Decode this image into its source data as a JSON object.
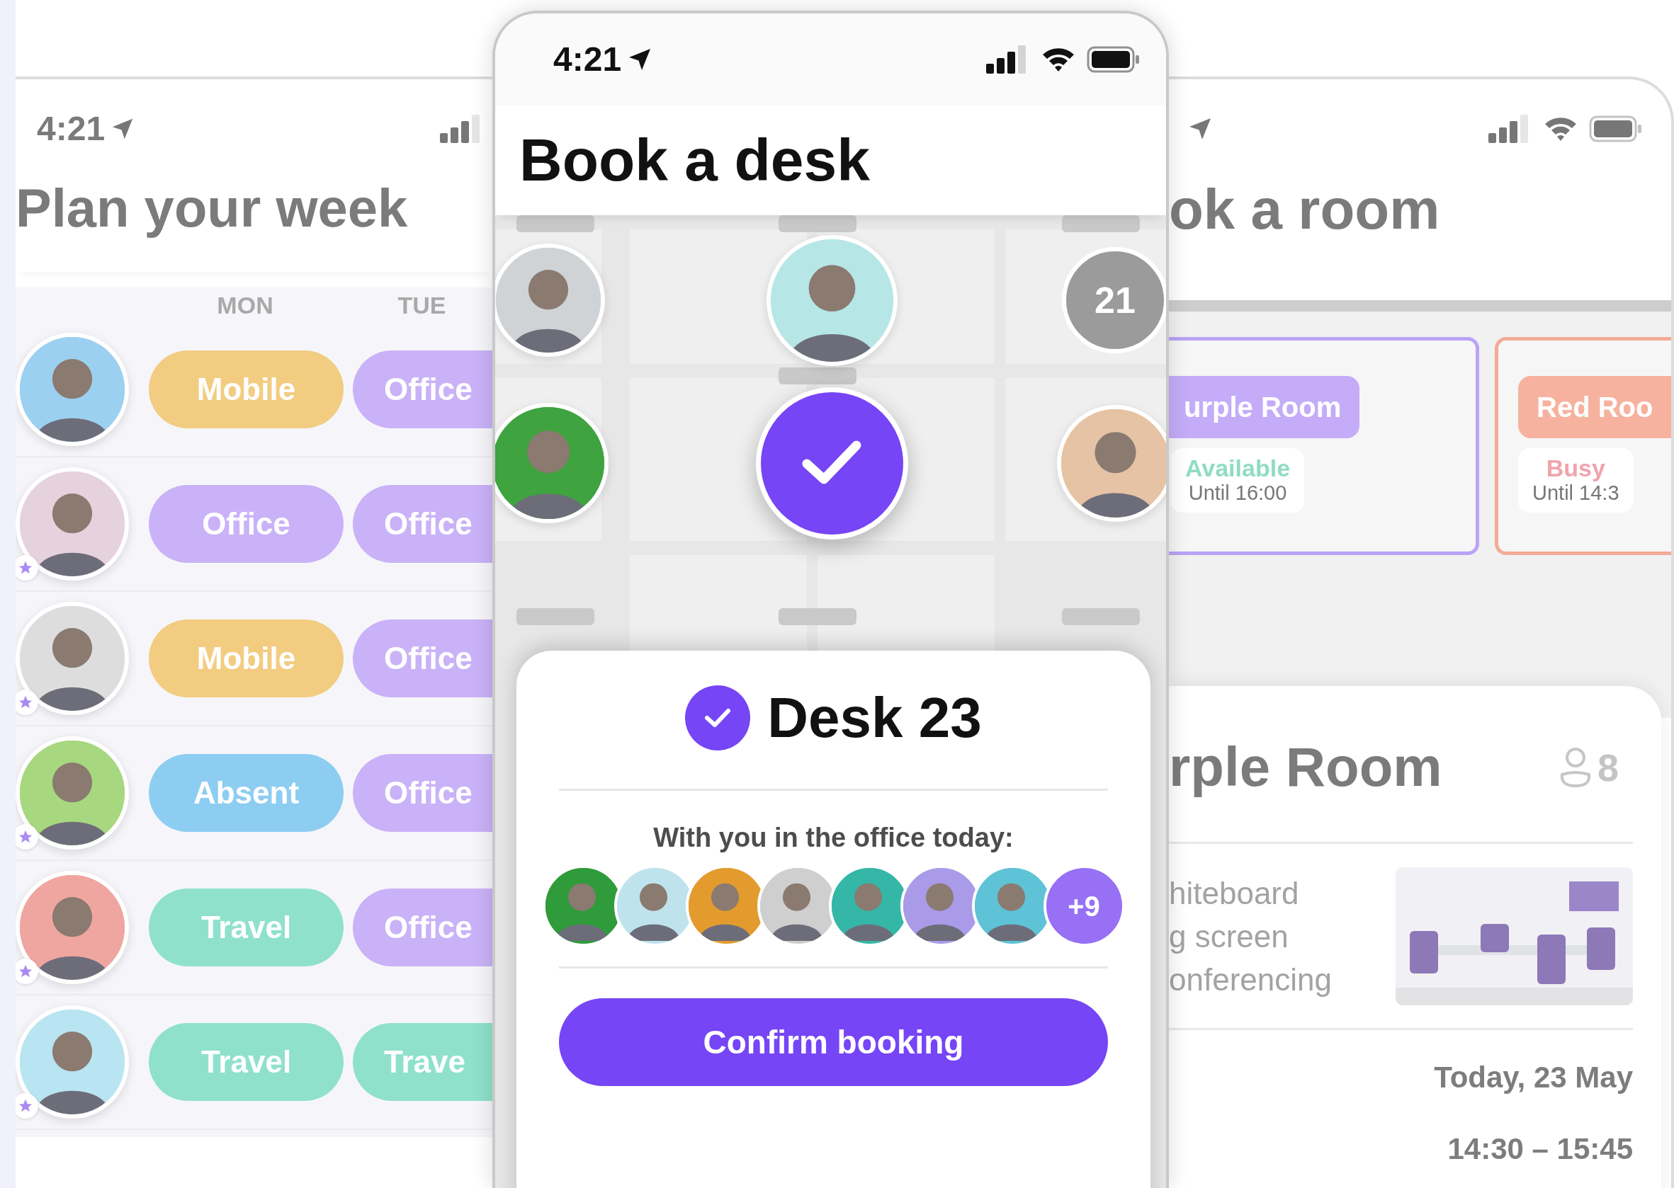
{
  "left_screen": {
    "status_bar": {
      "time": "4:21"
    },
    "title": "Plan your week",
    "days": [
      "MON",
      "TUE"
    ],
    "people": [
      {
        "favorite": false,
        "entries": [
          {
            "kind": "mobile",
            "label": "Mobile"
          },
          {
            "kind": "office",
            "label": "Office"
          }
        ]
      },
      {
        "favorite": true,
        "entries": [
          {
            "kind": "office",
            "label": "Office"
          },
          {
            "kind": "office",
            "label": "Office"
          }
        ]
      },
      {
        "favorite": true,
        "entries": [
          {
            "kind": "mobile",
            "label": "Mobile"
          },
          {
            "kind": "office",
            "label": "Office"
          }
        ]
      },
      {
        "favorite": true,
        "entries": [
          {
            "kind": "absent",
            "label": "Absent"
          },
          {
            "kind": "office",
            "label": "Office"
          }
        ]
      },
      {
        "favorite": true,
        "entries": [
          {
            "kind": "travel",
            "label": "Travel"
          },
          {
            "kind": "office",
            "label": "Office"
          }
        ]
      },
      {
        "favorite": true,
        "entries": [
          {
            "kind": "travel",
            "label": "Travel"
          },
          {
            "kind": "travel",
            "label": "Trave"
          }
        ]
      }
    ]
  },
  "center_screen": {
    "status_bar": {
      "time": "4:21"
    },
    "title": "Book a desk",
    "map": {
      "desks": [
        {
          "kind": "photo"
        },
        {
          "kind": "photo"
        },
        {
          "kind": "count",
          "label": "21"
        },
        {
          "kind": "photo"
        },
        {
          "kind": "selected"
        },
        {
          "kind": "photo"
        }
      ]
    },
    "sheet": {
      "title": "Desk 23",
      "subtitle": "With you in the office today:",
      "colleagues": [
        {
          "kind": "photo"
        },
        {
          "kind": "photo"
        },
        {
          "kind": "photo"
        },
        {
          "kind": "photo"
        },
        {
          "kind": "photo"
        },
        {
          "kind": "photo"
        },
        {
          "kind": "photo"
        },
        {
          "kind": "more",
          "label": "+9"
        }
      ],
      "button": "Confirm booking"
    }
  },
  "right_screen": {
    "title": "ok a room",
    "rooms": [
      {
        "kind": "available",
        "name": "urple Room",
        "status": "Available",
        "until": "Until 16:00"
      },
      {
        "kind": "busy",
        "name": "Red Roo",
        "status": "Busy",
        "until": "Until 14:3"
      }
    ],
    "room_card": {
      "title": "rple Room",
      "capacity": "8",
      "features": [
        "hiteboard",
        "g screen",
        "onferencing"
      ],
      "date": "Today, 23 May",
      "time": "14:30 – 15:45"
    }
  }
}
